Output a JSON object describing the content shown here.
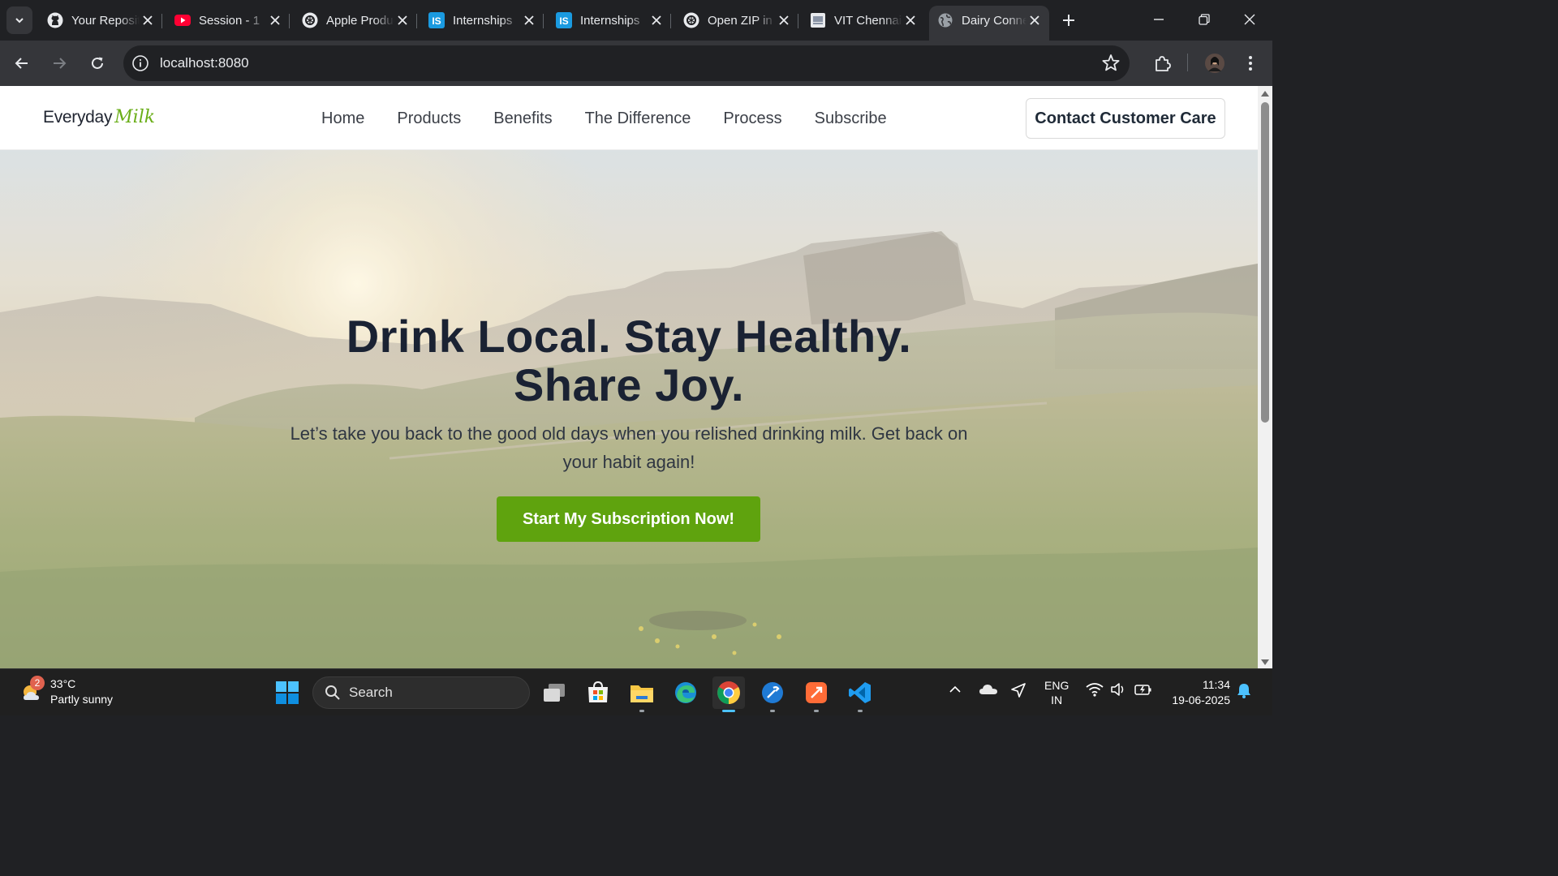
{
  "browser": {
    "tabs": [
      {
        "title": "Your Repositories",
        "icon": "github-icon"
      },
      {
        "title": "Session - 1",
        "icon": "youtube-icon"
      },
      {
        "title": "Apple Products",
        "icon": "openai-icon"
      },
      {
        "title": "Internships",
        "icon": "internshala-icon"
      },
      {
        "title": "Internships",
        "icon": "internshala-icon"
      },
      {
        "title": "Open ZIP in",
        "icon": "openai-icon"
      },
      {
        "title": "VIT Chennai",
        "icon": "vit-icon"
      },
      {
        "title": "Dairy Connect",
        "icon": "globe-icon",
        "active": true
      }
    ],
    "url": "localhost:8080"
  },
  "site": {
    "logo_text": "Everyday",
    "logo_script": "Milk",
    "nav": [
      "Home",
      "Products",
      "Benefits",
      "The Difference",
      "Process",
      "Subscribe"
    ],
    "contact_button": "Contact Customer Care",
    "hero": {
      "title_line1": "Drink Local. Stay Healthy.",
      "title_line2": "Share Joy.",
      "subtitle": "Let’s take you back to the good old days when you relished drinking milk. Get back on your habit again!",
      "cta": "Start My Subscription Now!"
    },
    "colors": {
      "accent": "#5fa30e",
      "heading": "#1a2233"
    }
  },
  "taskbar": {
    "weather_temp": "33°C",
    "weather_desc": "Partly sunny",
    "weather_badge": "2",
    "search_placeholder": "Search",
    "lang_line1": "ENG",
    "lang_line2": "IN",
    "time": "11:34",
    "date": "19-06-2025"
  }
}
